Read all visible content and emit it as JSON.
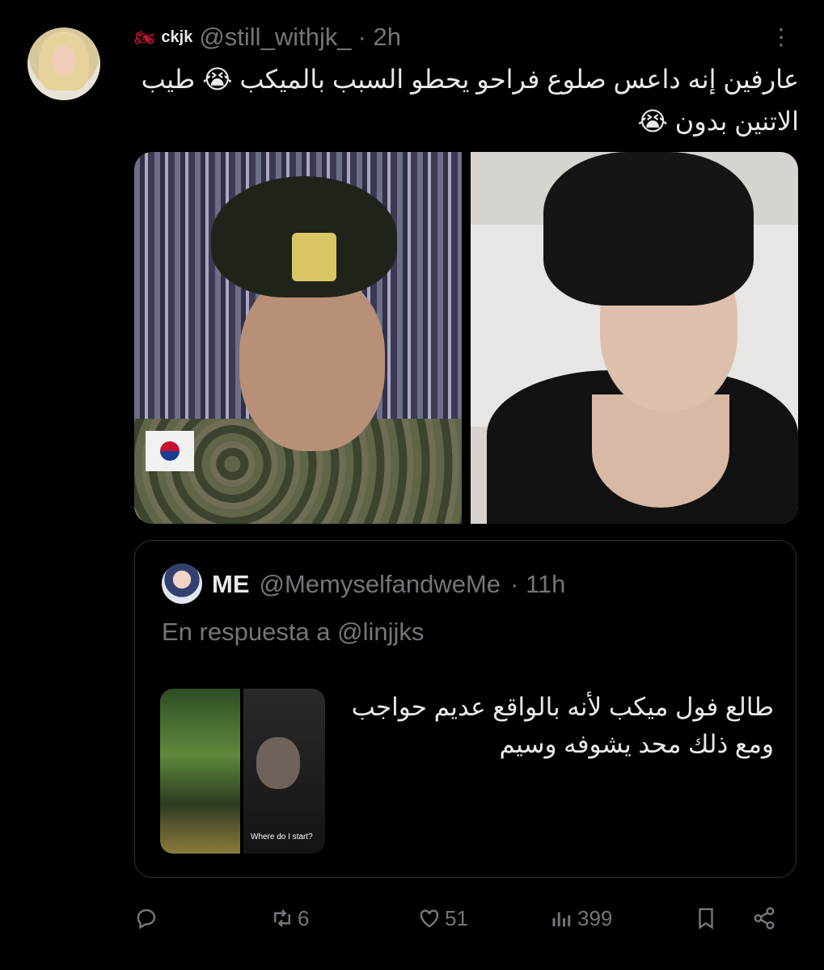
{
  "tweet": {
    "display_name": "ckjk",
    "name_emoji": "🏍",
    "handle": "@still_withjk_",
    "time": "· 2h",
    "more": "⋮",
    "text": "عارفين إنه داعس صلوع فراحو يحطو السبب بالميكب 😭 طيب الاتنين بدون 😭"
  },
  "quoted": {
    "display_name": "ME",
    "handle": "@MemyselfandweMe",
    "time": "· 11h",
    "reply_to": "En respuesta a @linjjks",
    "text": "طالع فول ميكب لأنه بالواقع عديم حواجب ومع ذلك محد يشوفه وسيم",
    "media_caption": "Where do I start?"
  },
  "actions": {
    "reply_count": "",
    "retweet_count": "6",
    "like_count": "51",
    "view_count": "399"
  },
  "icons": [
    "more-icon",
    "reply-icon",
    "retweet-icon",
    "like-icon",
    "views-icon",
    "bookmark-icon",
    "share-icon"
  ]
}
